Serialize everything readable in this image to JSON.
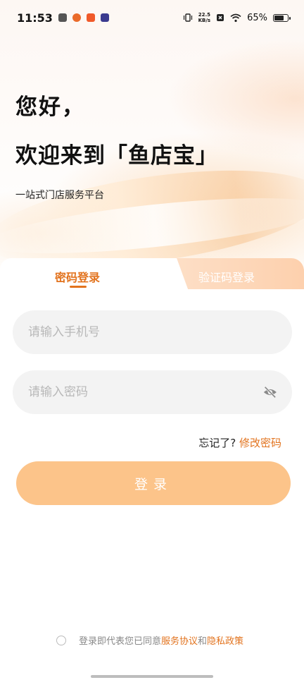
{
  "status_bar": {
    "time": "11:53",
    "net_speed_value": "22.5",
    "net_speed_unit": "KB/s",
    "battery": "65%"
  },
  "hero": {
    "greeting": "您好，",
    "welcome": "欢迎来到「鱼店宝」",
    "subtitle": "一站式门店服务平台"
  },
  "tabs": {
    "password_login": "密码登录",
    "code_login": "验证码登录"
  },
  "form": {
    "phone_placeholder": "请输入手机号",
    "password_placeholder": "请输入密码"
  },
  "forgot": {
    "prefix": "忘记了?",
    "link": "修改密码"
  },
  "login_button": "登录",
  "agreement": {
    "prefix": "登录即代表您已同意",
    "terms": "服务协议",
    "and": "和",
    "privacy": "隐私政策"
  },
  "colors": {
    "accent": "#e2731e",
    "button": "#fcc48a"
  }
}
